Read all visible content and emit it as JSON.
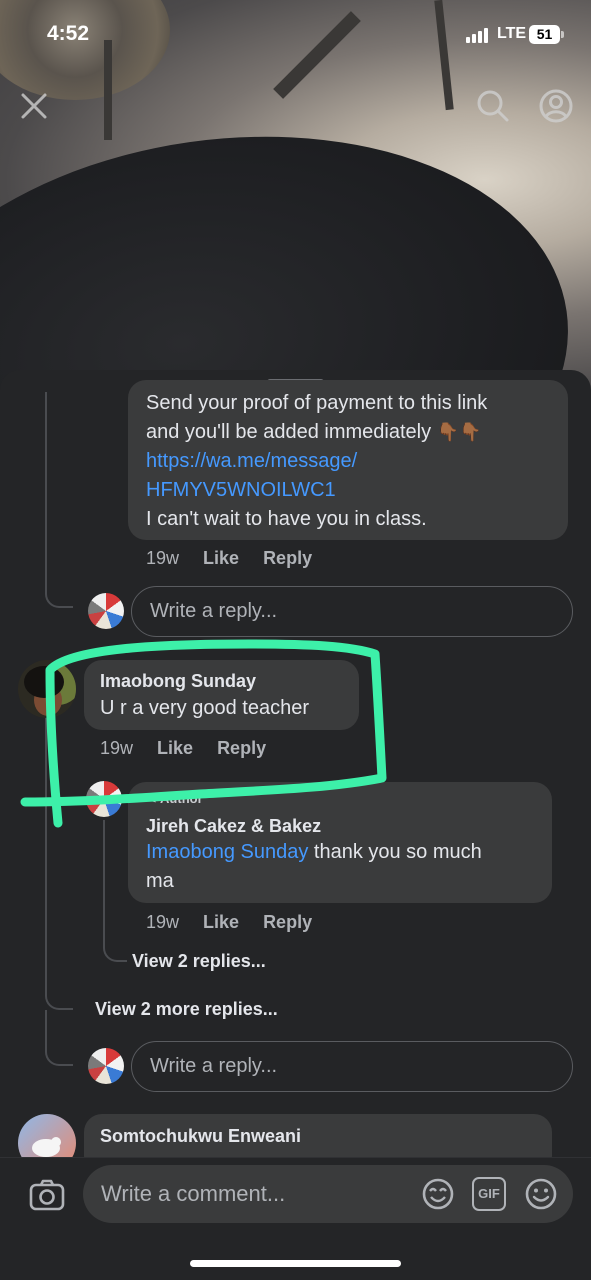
{
  "status_bar": {
    "time": "4:52",
    "network": "LTE",
    "battery": "51"
  },
  "top_bar": {
    "close_icon": "close-icon",
    "search_icon": "search-icon",
    "profile_icon": "profile-icon"
  },
  "comments": {
    "prev_reply": {
      "lines": [
        "Send your proof of payment to this link",
        "and you'll be added immediately"
      ],
      "emoji": "👇🏾👇🏾",
      "link_line1": "https://wa.me/message/",
      "link_line2": "HFMYV5WNOILWC1",
      "closing": "I can't wait to have you in class.",
      "time": "19w",
      "like": "Like",
      "reply": "Reply"
    },
    "reply_placeholder_1": "Write a reply...",
    "highlighted": {
      "author": "Imaobong Sunday",
      "text": "U r a very good teacher",
      "time": "19w",
      "like": "Like",
      "reply": "Reply"
    },
    "author_reply": {
      "badge": "Author",
      "author": "Jireh Cakez & Bakez",
      "mention": "Imaobong Sunday",
      "text_rest": " thank you so much",
      "text_line2": "ma",
      "time": "19w",
      "like": "Like",
      "reply": "Reply"
    },
    "view_replies": "View 2 replies...",
    "view_more_replies": "View 2 more replies...",
    "reply_placeholder_2": "Write a reply...",
    "next_comment": {
      "author": "Somtochukwu Enweani"
    }
  },
  "composer": {
    "placeholder": "Write a comment...",
    "camera_icon": "camera-icon",
    "sticker_icon": "sticker-icon",
    "gif_label": "GIF",
    "emoji_icon": "emoji-icon"
  },
  "colors": {
    "link": "#4599ff",
    "highlight": "#3df0a9",
    "bubble": "#3a3b3c",
    "sheet": "#242527"
  }
}
